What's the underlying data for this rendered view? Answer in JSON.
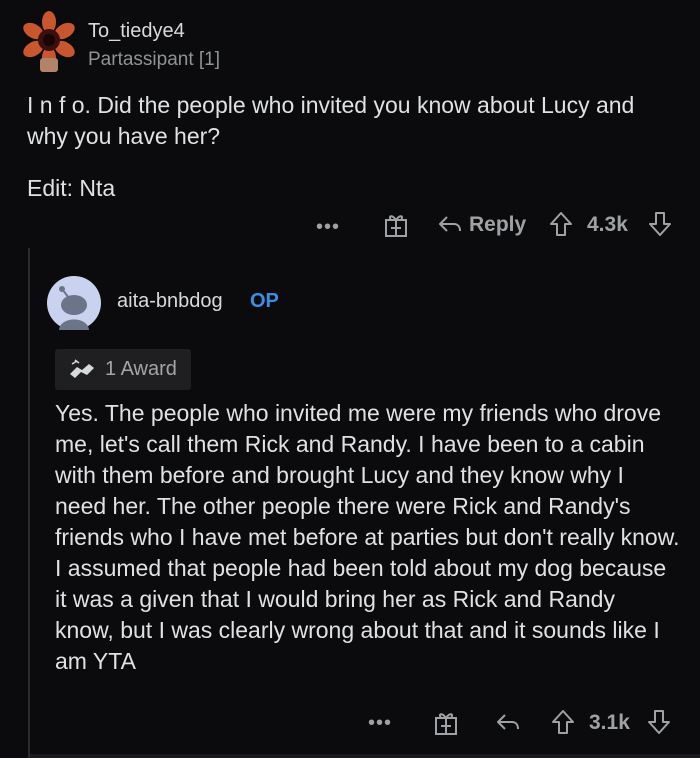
{
  "comment1": {
    "username": "To_tiedye4",
    "flair": "Partassipant [1]",
    "paragraphs": [
      "I n f o. Did the people who invited you know about Lucy and why you have her?",
      "Edit: Nta"
    ],
    "actions": {
      "more": "•••",
      "reply": "Reply",
      "score": "4.3k"
    }
  },
  "comment2": {
    "username": "aita-bnbdog",
    "op_badge": "OP",
    "award": "1 Award",
    "body": "Yes. The people who invited me were my friends who drove me, let's call them Rick and Randy. I have been to a cabin with them before and brought Lucy and they know why I need her. The other people there were Rick and Randy's friends who I have met before at parties but don't really know. I assumed that people had been told about my dog because it was a given that I would bring her as Rick and Randy know, but I was clearly wrong about that and it sounds like I am YTA",
    "actions": {
      "more": "•••",
      "score": "3.1k"
    }
  },
  "colors": {
    "background": "#0b0b0d",
    "text": "#dfe1e3",
    "muted": "#9ea2a5",
    "op_blue": "#3a8ee6",
    "avatar_bg": "#c9d2ee"
  }
}
